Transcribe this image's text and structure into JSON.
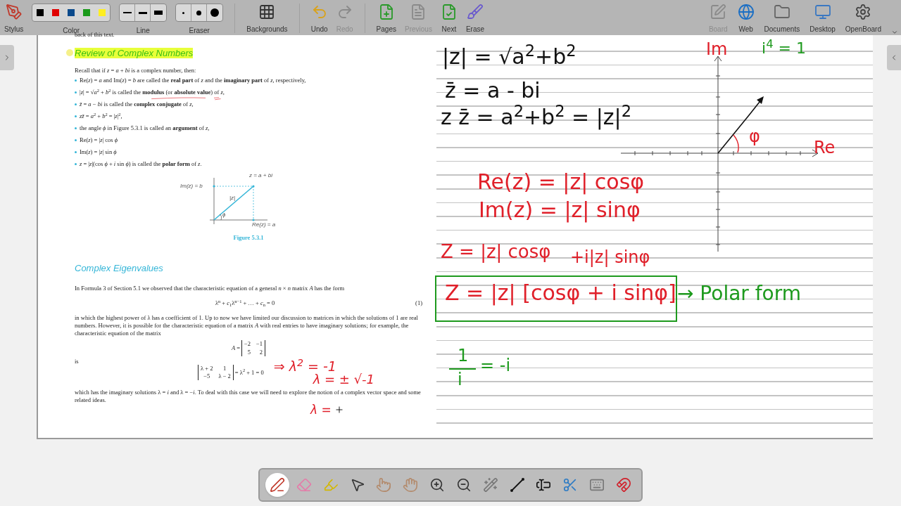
{
  "toolbar": {
    "left": [
      {
        "kind": "stylus",
        "label": "Stylus",
        "disabled": false
      },
      {
        "kind": "colors",
        "label": "Color",
        "disabled": false,
        "swatches": [
          {
            "color": "#000000"
          },
          {
            "color": "#e00000"
          },
          {
            "color": "#0b4a8c"
          },
          {
            "color": "#1a9a1a"
          },
          {
            "color": "#ffee22"
          }
        ]
      },
      {
        "kind": "line",
        "label": "Line",
        "disabled": false
      },
      {
        "kind": "eraser",
        "label": "Eraser",
        "disabled": false
      },
      {
        "kind": "backgrounds",
        "label": "Backgrounds",
        "disabled": false
      },
      {
        "kind": "undo",
        "label": "Undo",
        "disabled": false
      },
      {
        "kind": "redo",
        "label": "Redo",
        "disabled": true
      },
      {
        "kind": "pages",
        "label": "Pages",
        "disabled": false
      },
      {
        "kind": "previous",
        "label": "Previous",
        "disabled": true
      },
      {
        "kind": "next",
        "label": "Next",
        "disabled": false
      },
      {
        "kind": "erase",
        "label": "Erase",
        "disabled": false
      }
    ],
    "right": [
      {
        "kind": "board",
        "label": "Board",
        "disabled": true
      },
      {
        "kind": "web",
        "label": "Web",
        "disabled": false
      },
      {
        "kind": "documents",
        "label": "Documents",
        "disabled": false
      },
      {
        "kind": "desktop",
        "label": "Desktop",
        "disabled": false
      },
      {
        "kind": "openboard",
        "label": "OpenBoard",
        "disabled": false
      }
    ]
  },
  "document": {
    "cut_line": "back of this text.",
    "heading1": {
      "text": "Review of Complex Numbers",
      "highlighted": true
    },
    "intro": "Recall that if *z* = *a* + *bi* is a complex number, then:",
    "bullets": [
      "Re(*z*) = *a* and Im(*z*) = *b* are called the **real part** of *z* and the **imaginary part** of *z*, respectively,",
      "|*z*| = √*a*$^{2}$ + *b*$^{2}$ is called the **modulus** (or **absolute value**) of *z*,",
      "*z̄* = *a* − *bi* is called the **complex conjugate** of *z*,",
      "*zz̄* = *a*$^{2}$ + *b*$^{2}$ = |*z*|$^{2}$,",
      "the angle *ϕ* in Figure 5.3.1 is called an **argument** of *z*,",
      "Re(*z*) = |*z*| cos *ϕ*",
      "Im(*z*) = |*z*| sin *ϕ*",
      "*z* = |*z*|(cos *ϕ* + *i* sin *ϕ*) is called the **polar form** of *z*."
    ],
    "figure": {
      "labels": [
        "Im(z) = b",
        "z = a + bi",
        "|z|",
        "ϕ",
        "Re(z) = a"
      ],
      "caption": "Figure 5.3.1"
    },
    "heading2": {
      "text": "Complex Eigenvalues",
      "highlighted": false
    },
    "para1": "In Formula 3 of Section 5.1 we observed that the characteristic equation of a general *n* × *n* matrix *A* has the form",
    "equation": {
      "text": "λ$^{n}$ + *c*$_{1}$λ$^{n−1}$ + … + *c*$_{n}$ = 0",
      "number": "(1)"
    },
    "para2": "in which the highest power of λ has a coefficient of 1. Up to now we have limited our discussion to matrices in which the solutions of 1 are real numbers. However, it is possible for the characteristic equation of a matrix *A* with real entries to have imaginary solutions; for example, the characteristic equation of the matrix",
    "matrix": {
      "name": "*A* =",
      "cells": [
        "−2",
        "−1",
        "5",
        "2"
      ]
    },
    "is": "is",
    "determinant": {
      "cells": [
        "λ + 2",
        "1",
        "−5",
        "λ − 2"
      ],
      "result": "= λ$^{2}$ + 1 = 0"
    },
    "para3": "which has the imaginary solutions λ = *i* and λ = −*i*. To deal with this case we will need to explore the notion of a complex vector space and some related ideas.",
    "inks": [
      {
        "text": "⇒ λ$^{2}$ = -1",
        "color": "#e0202a"
      },
      {
        "text": "λ = ± √-1",
        "color": "#e0202a"
      },
      {
        "text": "λ =",
        "color": "#e0202a"
      }
    ]
  },
  "notes": {
    "inks": [
      {
        "text": "|z| = √a$^{2}$+b$^{2}$",
        "color": "#111111"
      },
      {
        "text": "z̄ = a - bi",
        "color": "#111111"
      },
      {
        "text": "z z̄ = a$^{2}$+b$^{2}$ = |z|$^{2}$",
        "color": "#111111"
      },
      {
        "text": "Im",
        "color": "#e0202a"
      },
      {
        "text": "i$^{4}$ = 1",
        "color": "#1e9a1e"
      },
      {
        "text": "φ",
        "color": "#e0202a"
      },
      {
        "text": "Re",
        "color": "#e0202a"
      },
      {
        "text": "Re(z) = |z| cosφ",
        "color": "#e0202a"
      },
      {
        "text": "Im(z) = |z| sinφ",
        "color": "#e0202a"
      },
      {
        "text": "Z = |z| cosφ",
        "color": "#e0202a"
      },
      {
        "text": "+i|z| sinφ",
        "color": "#e0202a"
      },
      {
        "text": "Z = |z| [cosφ + i sinφ]",
        "color": "#e0202a"
      },
      {
        "text": "→ Polar form",
        "color": "#1e9a1e"
      },
      {
        "text": "1",
        "color": "#1e9a1e"
      },
      {
        "text": "i",
        "color": "#1e9a1e"
      },
      {
        "text": "= -i",
        "color": "#1e9a1e"
      }
    ]
  },
  "tools": [
    {
      "kind": "pen",
      "selected": true
    },
    {
      "kind": "eraser",
      "selected": false
    },
    {
      "kind": "marker",
      "selected": false
    },
    {
      "kind": "pointer",
      "selected": false
    },
    {
      "kind": "play",
      "selected": false
    },
    {
      "kind": "hand",
      "selected": false
    },
    {
      "kind": "zoom-in",
      "selected": false
    },
    {
      "kind": "zoom-out",
      "selected": false
    },
    {
      "kind": "laser",
      "selected": false
    },
    {
      "kind": "line",
      "selected": false
    },
    {
      "kind": "text",
      "selected": false
    },
    {
      "kind": "capture",
      "selected": false
    },
    {
      "kind": "keyboard",
      "selected": false
    },
    {
      "kind": "magnet",
      "selected": false
    }
  ]
}
